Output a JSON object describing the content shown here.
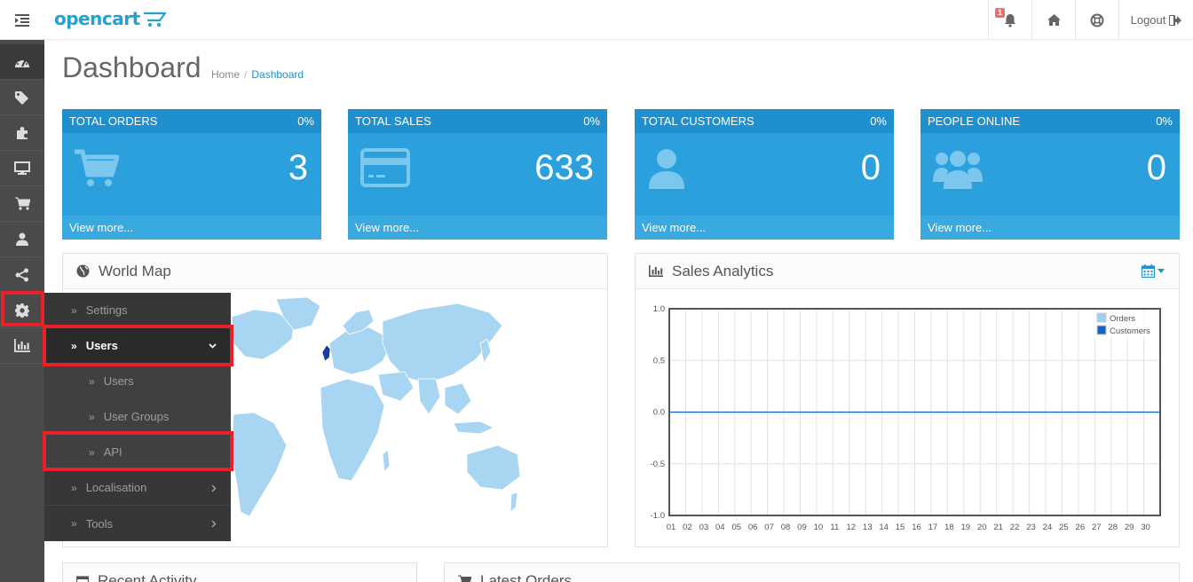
{
  "header": {
    "logo": "opencart",
    "alerts_count": "1",
    "logout_label": "Logout"
  },
  "sidebar": {
    "icons": [
      "dashboard-icon",
      "tags-icon",
      "puzzle-icon",
      "desktop-icon",
      "cart-icon",
      "user-icon",
      "share-icon",
      "gear-icon",
      "bar-chart-icon"
    ]
  },
  "flyout": {
    "settings": "Settings",
    "users_group": "Users",
    "users": "Users",
    "user_groups": "User Groups",
    "api": "API",
    "localisation": "Localisation",
    "tools": "Tools"
  },
  "page": {
    "title": "Dashboard",
    "breadcrumb": [
      "Home",
      "Dashboard"
    ]
  },
  "tiles": [
    {
      "title": "TOTAL ORDERS",
      "percent": "0%",
      "value": "3",
      "footer": "View more..."
    },
    {
      "title": "TOTAL SALES",
      "percent": "0%",
      "value": "633",
      "footer": "View more..."
    },
    {
      "title": "TOTAL CUSTOMERS",
      "percent": "0%",
      "value": "0",
      "footer": "View more..."
    },
    {
      "title": "PEOPLE ONLINE",
      "percent": "0%",
      "value": "0",
      "footer": "View more..."
    }
  ],
  "panels": {
    "world_map": "World Map",
    "sales_analytics": "Sales Analytics",
    "recent_activity": "Recent Activity",
    "latest_orders": "Latest Orders"
  },
  "colors": {
    "accent": "#2ba0dc",
    "sidebar": "#4a4a4a",
    "highlight": "#e8202a",
    "orders": "#9dd0ee",
    "customers": "#1065c0"
  },
  "chart_data": {
    "type": "line",
    "x": [
      "01",
      "02",
      "03",
      "04",
      "05",
      "06",
      "07",
      "08",
      "09",
      "10",
      "11",
      "12",
      "13",
      "14",
      "15",
      "16",
      "17",
      "18",
      "19",
      "20",
      "21",
      "22",
      "23",
      "24",
      "25",
      "26",
      "27",
      "28",
      "29",
      "30"
    ],
    "series": [
      {
        "name": "Orders",
        "values": [
          0,
          0,
          0,
          0,
          0,
          0,
          0,
          0,
          0,
          0,
          0,
          0,
          0,
          0,
          0,
          0,
          0,
          0,
          0,
          0,
          0,
          0,
          0,
          0,
          0,
          0,
          0,
          0,
          0,
          0
        ]
      },
      {
        "name": "Customers",
        "values": [
          0,
          0,
          0,
          0,
          0,
          0,
          0,
          0,
          0,
          0,
          0,
          0,
          0,
          0,
          0,
          0,
          0,
          0,
          0,
          0,
          0,
          0,
          0,
          0,
          0,
          0,
          0,
          0,
          0,
          0
        ]
      }
    ],
    "yticks": [
      "1.0",
      "0.5",
      "0.0",
      "-0.5",
      "-1.0"
    ],
    "ylim": [
      -1,
      1
    ],
    "grid": true,
    "legend": "top-right"
  }
}
